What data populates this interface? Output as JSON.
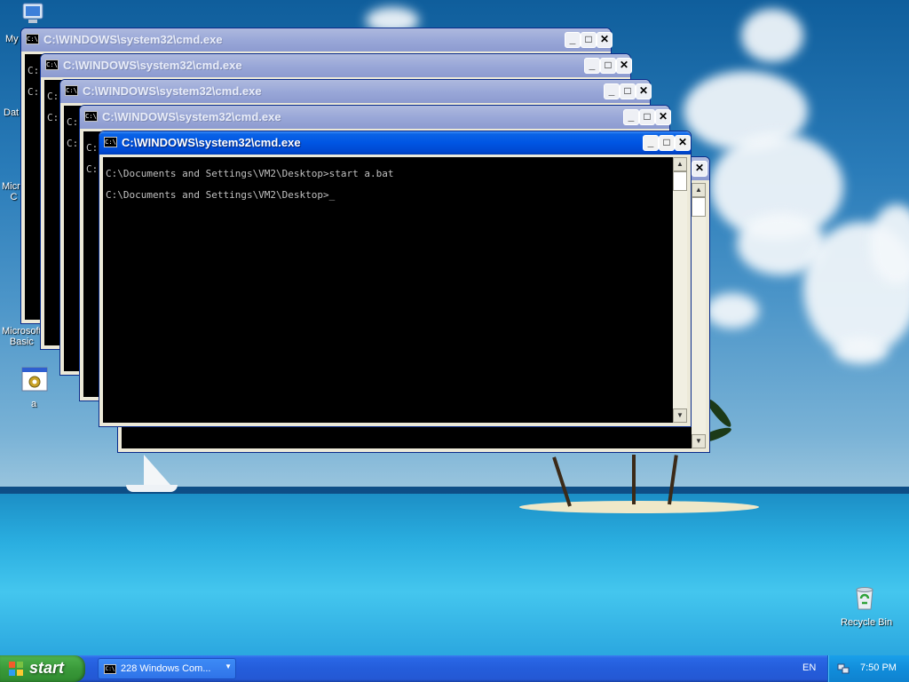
{
  "desktop": {
    "icons": [
      {
        "id": "my-computer",
        "label": "My"
      },
      {
        "id": "data",
        "label": "Dat"
      },
      {
        "id": "microsoft-1",
        "label": "Micro\nC"
      },
      {
        "id": "microsoft-basic",
        "label": "Microsoft\nBasic"
      },
      {
        "id": "a-bat",
        "label": "a"
      },
      {
        "id": "recycle-bin",
        "label": "Recycle Bin"
      }
    ]
  },
  "windows": {
    "title": "C:\\WINDOWS\\system32\\cmd.exe",
    "icon_text": "C:\\",
    "prompt_partial": "C:",
    "active_lines": [
      "C:\\Documents and Settings\\VM2\\Desktop>start a.bat",
      "C:\\Documents and Settings\\VM2\\Desktop>_"
    ]
  },
  "taskbar": {
    "start_label": "start",
    "task_label": "228 Windows Com...",
    "task_icon_text": "C:\\",
    "language": "EN",
    "clock": "7:50 PM"
  },
  "colors": {
    "titlebar_active": "#0055e3",
    "titlebar_inactive": "#9aa8d8",
    "console_bg": "#000000",
    "console_text": "#c0c0c0",
    "taskbar": "#245ddb",
    "start_button": "#3a9a3a"
  }
}
